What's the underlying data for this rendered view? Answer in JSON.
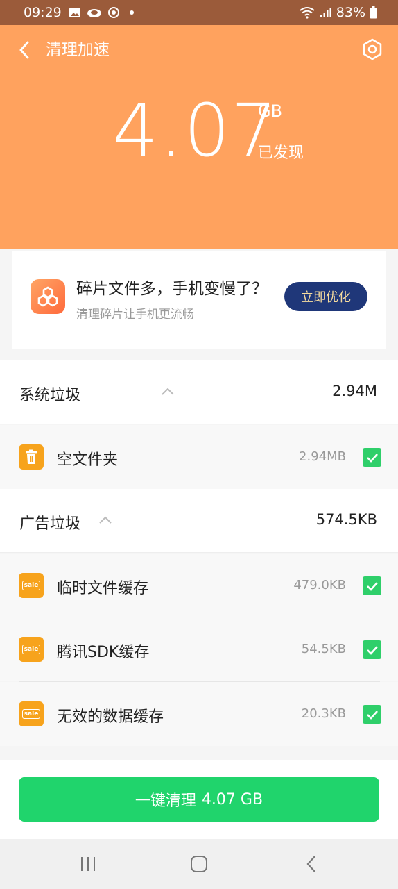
{
  "status_bar": {
    "time": "09:29",
    "battery": "83%"
  },
  "header": {
    "title": "清理加速",
    "found_size": "4.07",
    "unit": "GB",
    "found_label": "已发现"
  },
  "promo": {
    "title": "碎片文件多，手机变慢了？",
    "subtitle": "清理碎片让手机更流畅",
    "button": "立即优化"
  },
  "sections": [
    {
      "label": "系统垃圾",
      "size": "2.94M",
      "items": [
        {
          "name": "空文件夹",
          "size": "2.94MB",
          "icon": "trash-icon",
          "checked": true
        }
      ]
    },
    {
      "label": "广告垃圾",
      "size": "574.5KB",
      "items": [
        {
          "name": "临时文件缓存",
          "size": "479.0KB",
          "icon": "sale-icon",
          "checked": true
        },
        {
          "name": "腾讯SDK缓存",
          "size": "54.5KB",
          "icon": "sale-icon",
          "checked": true
        },
        {
          "name": "无效的数据缓存",
          "size": "20.3KB",
          "icon": "sale-icon",
          "checked": true
        }
      ]
    }
  ],
  "clean_button": {
    "label": "一键清理",
    "size": "4.07 GB"
  },
  "colors": {
    "header": "#ffa25e",
    "status_bar": "#9b5b3a",
    "accent_green": "#20d46c",
    "promo_button": "#1f3779"
  }
}
